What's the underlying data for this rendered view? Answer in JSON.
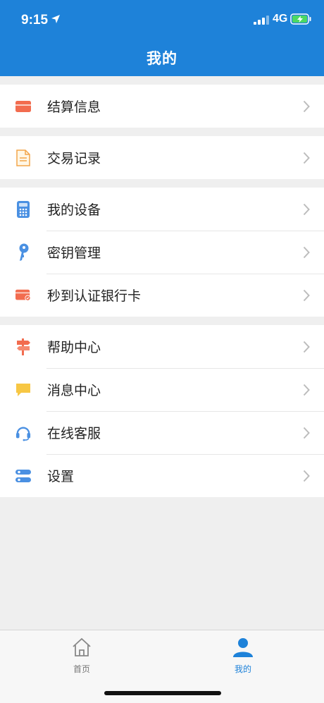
{
  "status_bar": {
    "time": "9:15",
    "network": "4G"
  },
  "header": {
    "title": "我的"
  },
  "groups": [
    {
      "items": [
        {
          "label": "结算信息",
          "icon": "card-icon"
        }
      ]
    },
    {
      "items": [
        {
          "label": "交易记录",
          "icon": "document-icon"
        }
      ]
    },
    {
      "items": [
        {
          "label": "我的设备",
          "icon": "calculator-icon"
        },
        {
          "label": "密钥管理",
          "icon": "key-icon"
        },
        {
          "label": "秒到认证银行卡",
          "icon": "verified-card-icon"
        }
      ]
    },
    {
      "items": [
        {
          "label": "帮助中心",
          "icon": "signpost-icon"
        },
        {
          "label": "消息中心",
          "icon": "message-icon"
        },
        {
          "label": "在线客服",
          "icon": "headset-icon"
        },
        {
          "label": "设置",
          "icon": "settings-icon"
        }
      ]
    }
  ],
  "tabbar": {
    "home_label": "首页",
    "mine_label": "我的"
  },
  "colors": {
    "header_bg": "#1e82d9",
    "active_tab": "#1e82d9",
    "inactive_tab": "#777777"
  }
}
